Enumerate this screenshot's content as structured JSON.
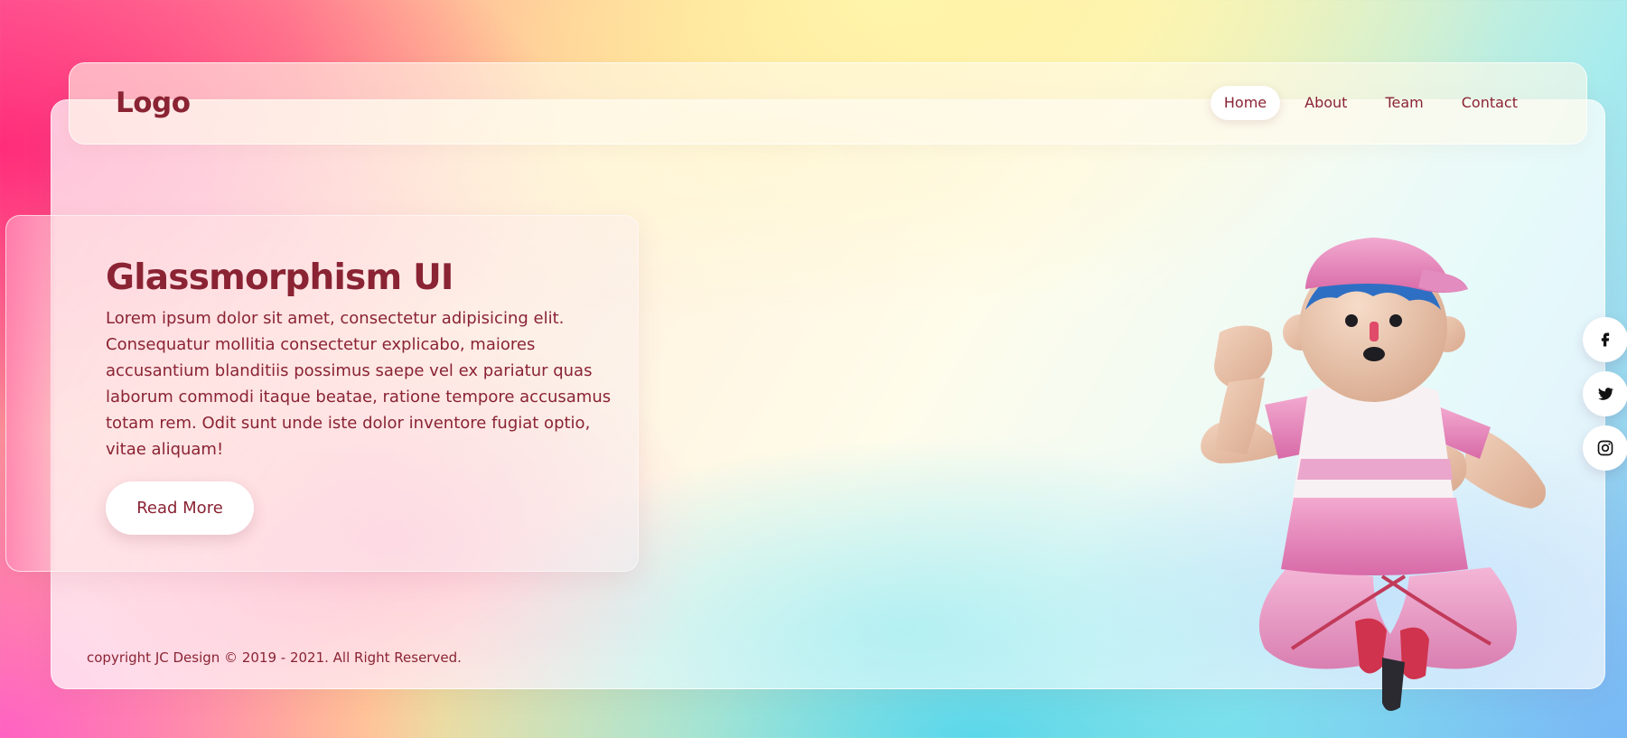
{
  "brand": {
    "logo": "Logo"
  },
  "nav": {
    "items": [
      {
        "label": "Home",
        "active": true
      },
      {
        "label": "About",
        "active": false
      },
      {
        "label": "Team",
        "active": false
      },
      {
        "label": "Contact",
        "active": false
      }
    ]
  },
  "hero": {
    "title": "Glassmorphism UI",
    "text": "Lorem ipsum dolor sit amet, consectetur adipisicing elit. Consequatur mollitia consectetur explicabo, maiores accusantium blanditiis possimus saepe vel ex pariatur quas laborum commodi itaque beatae, ratione tempore accusamus totam rem. Odit sunt unde iste dolor inventore fugiat optio, vitae aliquam!",
    "button_label": "Read More"
  },
  "footer": {
    "copyright": "copyright JC Design © 2019 - 2021. All Right Reserved."
  },
  "social": {
    "items": [
      {
        "icon": "facebook-icon"
      },
      {
        "icon": "twitter-icon"
      },
      {
        "icon": "instagram-icon"
      }
    ]
  },
  "colors": {
    "text": "#8a2333",
    "button_bg": "#ffffff"
  }
}
